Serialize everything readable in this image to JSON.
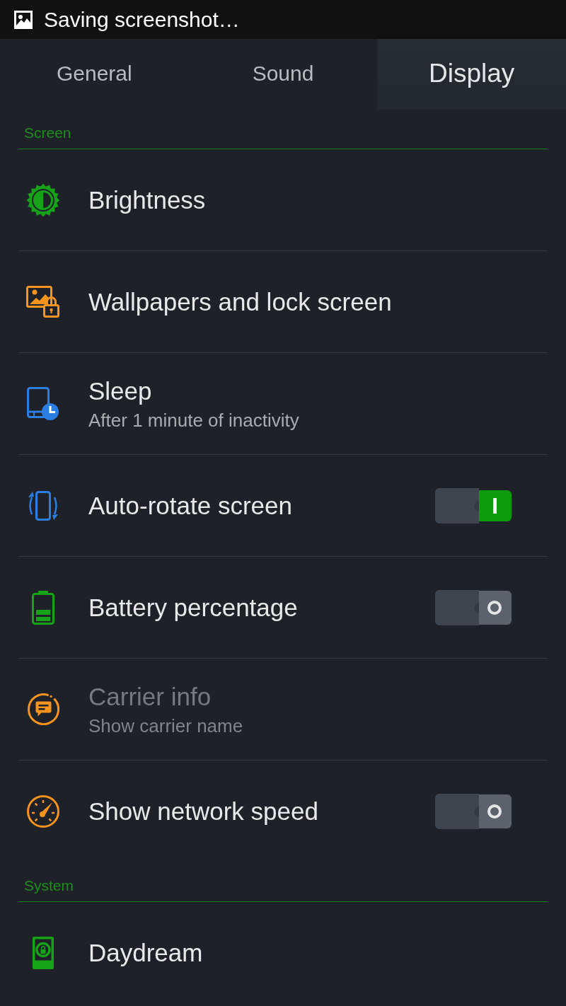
{
  "status_bar": {
    "text": "Saving screenshot…"
  },
  "tabs": [
    {
      "label": "General",
      "selected": false
    },
    {
      "label": "Sound",
      "selected": false
    },
    {
      "label": "Display",
      "selected": true
    }
  ],
  "sections": [
    {
      "title": "Screen",
      "items": [
        {
          "kind": "link",
          "title": "Brightness",
          "disabled": false
        },
        {
          "kind": "link",
          "title": "Wallpapers and lock screen",
          "disabled": false
        },
        {
          "kind": "link",
          "title": "Sleep",
          "subtitle": "After 1 minute of inactivity",
          "disabled": false
        },
        {
          "kind": "toggle",
          "title": "Auto-rotate screen",
          "on": true,
          "disabled": false
        },
        {
          "kind": "toggle",
          "title": "Battery percentage",
          "on": false,
          "disabled": false
        },
        {
          "kind": "link",
          "title": "Carrier info",
          "subtitle": "Show carrier name",
          "disabled": true
        },
        {
          "kind": "toggle",
          "title": "Show network speed",
          "on": false,
          "disabled": false
        }
      ]
    },
    {
      "title": "System",
      "items": [
        {
          "kind": "link",
          "title": "Daydream",
          "disabled": false
        }
      ]
    }
  ]
}
